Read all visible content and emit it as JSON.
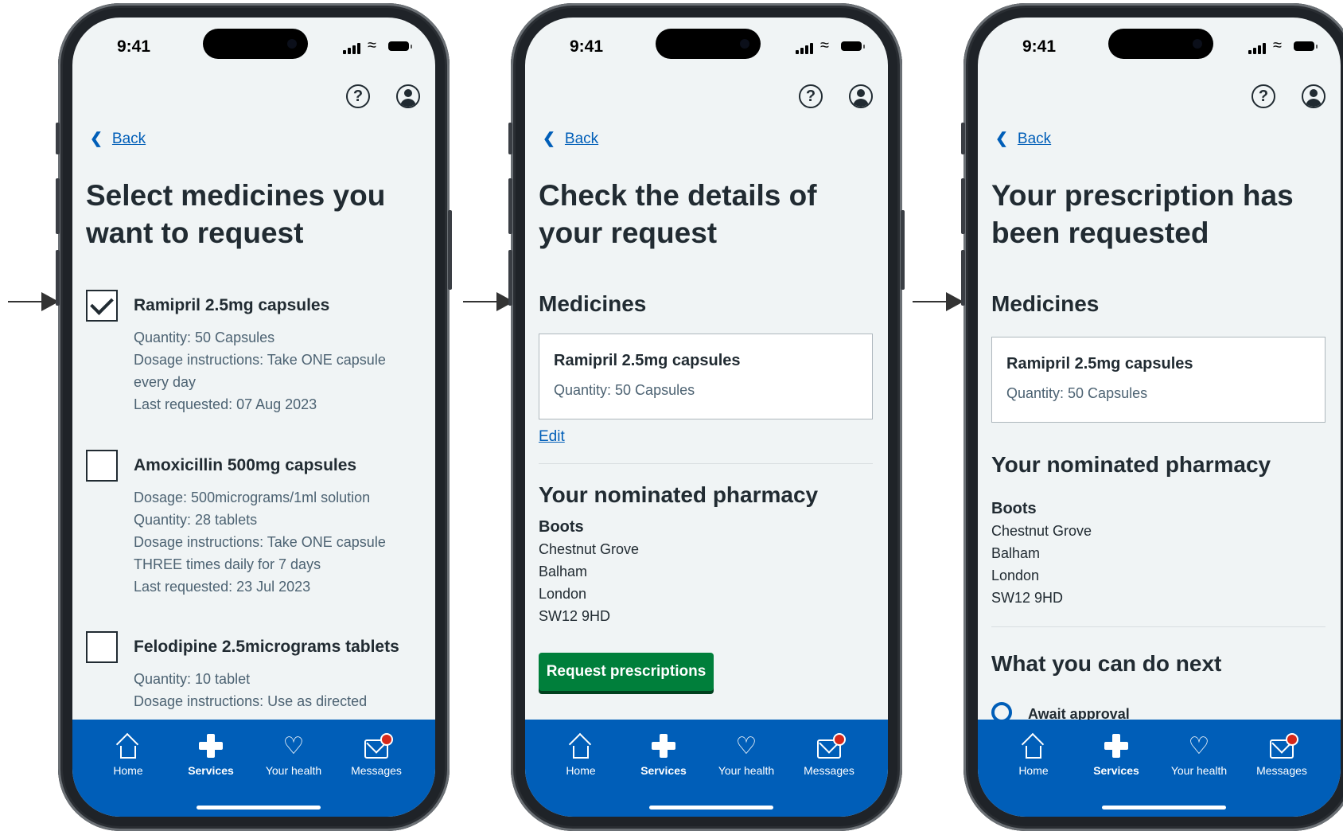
{
  "status": {
    "time": "9:41"
  },
  "common": {
    "back": "Back",
    "help_glyph": "?"
  },
  "tabs": [
    "Home",
    "Services",
    "Your health",
    "Messages"
  ],
  "screen1": {
    "title": "Select medicines you want to request",
    "medicines": [
      {
        "name": "Ramipril 2.5mg capsules",
        "checked": true,
        "lines": [
          "Quantity: 50 Capsules",
          "Dosage instructions: Take ONE capsule",
          "every day",
          "Last requested: 07 Aug 2023"
        ]
      },
      {
        "name": "Amoxicillin 500mg capsules",
        "checked": false,
        "lines": [
          "Dosage: 500micrograms/1ml solution",
          "Quantity: 28 tablets",
          "Dosage instructions: Take ONE capsule",
          "THREE times daily for 7 days",
          "Last requested: 23 Jul 2023"
        ]
      },
      {
        "name": "Felodipine 2.5micrograms tablets",
        "checked": false,
        "lines": [
          "Quantity: 10 tablet",
          "Dosage instructions: Use as directed"
        ]
      }
    ]
  },
  "screen2": {
    "title": "Check the details of your request",
    "medicines_heading": "Medicines",
    "card": {
      "name": "Ramipril 2.5mg capsules",
      "qty": "Quantity: 50 Capsules"
    },
    "edit": "Edit",
    "pharmacy_heading": "Your nominated pharmacy",
    "pharmacy": {
      "name": "Boots",
      "lines": [
        "Chestnut Grove",
        "Balham",
        "London",
        "SW12 9HD"
      ]
    },
    "button": "Request prescriptions"
  },
  "screen3": {
    "title": "Your prescription has been requested",
    "medicines_heading": "Medicines",
    "card": {
      "name": "Ramipril 2.5mg capsules",
      "qty": "Quantity: 50 Capsules"
    },
    "pharmacy_heading": "Your nominated pharmacy",
    "pharmacy": {
      "name": "Boots",
      "lines": [
        "Chestnut Grove",
        "Balham",
        "London",
        "SW12 9HD"
      ]
    },
    "next_heading": "What you can do next",
    "next_item": "Await approval"
  },
  "colors": {
    "nhs_blue": "#005eb8",
    "nhs_green": "#007f3b",
    "background": "#f0f4f5",
    "badge_red": "#d5281b"
  },
  "icons": [
    "help-icon",
    "account-icon",
    "back-chevron-icon",
    "home-icon",
    "services-cross-icon",
    "heart-icon",
    "messages-envelope-icon"
  ]
}
